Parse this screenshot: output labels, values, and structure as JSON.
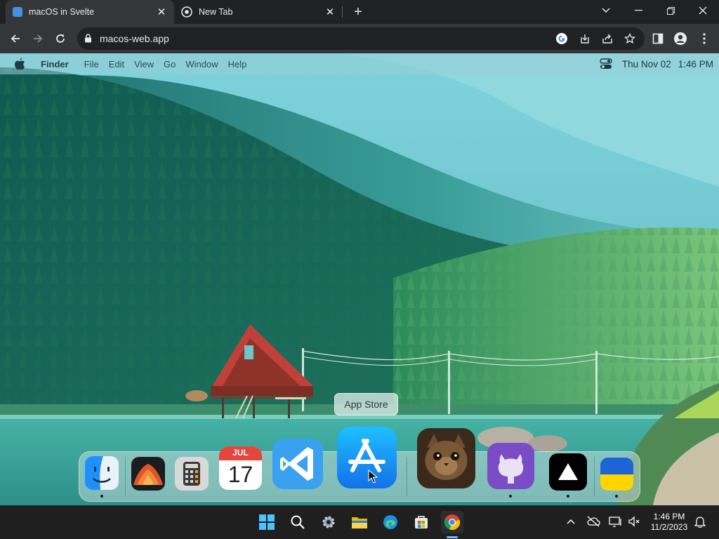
{
  "browser": {
    "tabs": [
      {
        "title": "macOS in Svelte",
        "active": true
      },
      {
        "title": "New Tab",
        "active": false
      }
    ],
    "address": "macos-web.app"
  },
  "menubar": {
    "app_name": "Finder",
    "menus": [
      "File",
      "Edit",
      "View",
      "Go",
      "Window",
      "Help"
    ],
    "date": "Thu Nov 02",
    "time": "1:46 PM"
  },
  "dock": {
    "tooltip": "App Store",
    "calendar": {
      "month": "JUL",
      "day": "17"
    },
    "apps": [
      {
        "icon": "finder-icon",
        "running": true
      },
      {
        "icon": "wallpapers-icon",
        "running": false
      },
      {
        "icon": "calculator-icon",
        "running": false
      },
      {
        "icon": "calendar-icon",
        "running": false
      },
      {
        "icon": "vscode-icon",
        "running": false
      },
      {
        "icon": "app-store-icon",
        "running": false
      },
      {
        "icon": "purrfect-cat-icon",
        "running": false
      },
      {
        "icon": "github-icon",
        "running": true
      },
      {
        "icon": "vercel-icon",
        "running": true
      },
      {
        "icon": "ukraine-flag-icon",
        "running": true
      }
    ]
  },
  "taskbar": {
    "time": "1:46 PM",
    "date": "11/2/2023"
  },
  "colors": {
    "chrome_frame": "#202124",
    "chrome_toolbar": "#35363a",
    "taskbar": "#1f1f1f",
    "taskbar_indicator": "#76b9ed"
  }
}
